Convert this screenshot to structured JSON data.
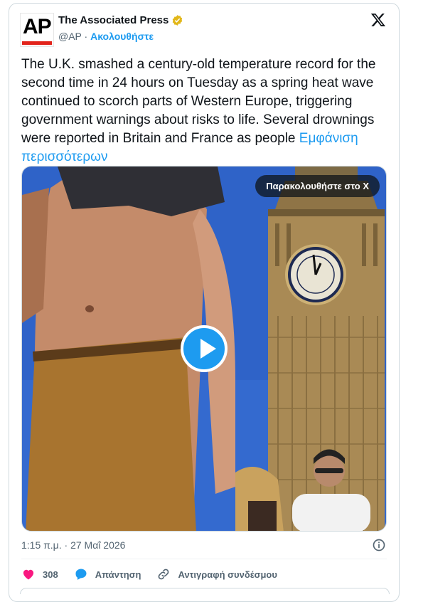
{
  "author": {
    "display_name": "The Associated Press",
    "handle": "@AP",
    "separator": "·",
    "follow_label": "Ακολουθήστε",
    "avatar_text": "AP",
    "verified_color": "#e2b719",
    "icon": "verified-badge-icon"
  },
  "brand_icon": "x-logo-icon",
  "tweet": {
    "text": "The U.K. smashed a century-old temperature record for the second time in 24 hours on Tuesday as a spring heat wave continued to scorch parts of Western Europe, triggering government warnings about risks to life. Several drownings were reported in Britain and France as people ",
    "show_more_label": "Εμφάνιση περισσότερων"
  },
  "media": {
    "watch_label": "Παρακολουθήστε στο X",
    "play_icon": "play-icon"
  },
  "meta": {
    "timestamp": "1:15 π.μ. · 27 Μαΐ 2026",
    "info_icon": "info-icon"
  },
  "actions": {
    "like_count": "308",
    "reply_label": "Απάντηση",
    "copy_link_label": "Αντιγραφή συνδέσμου"
  },
  "colors": {
    "accent": "#1d9bf0",
    "like": "#f91880",
    "text": "#0f1419",
    "secondary": "#536471"
  }
}
